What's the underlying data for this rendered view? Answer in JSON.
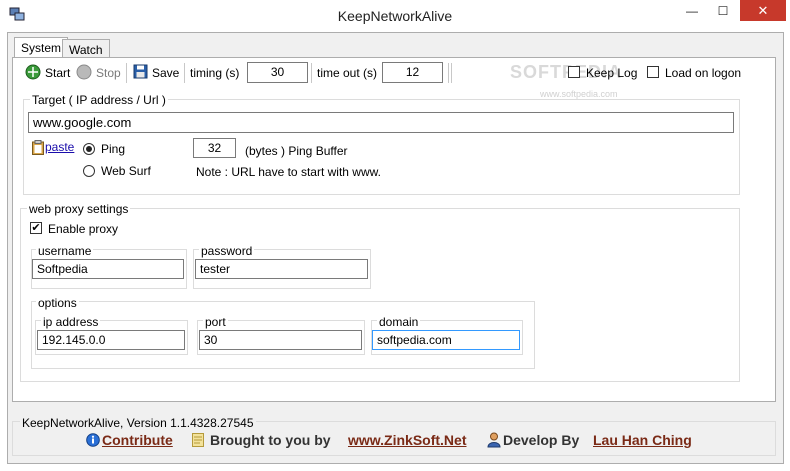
{
  "window": {
    "title": "KeepNetworkAlive",
    "minimize_glyph": "—",
    "maximize_glyph": "☐",
    "close_glyph": "✕"
  },
  "tabs": [
    {
      "label": "System"
    },
    {
      "label": "Watch"
    }
  ],
  "toolbar": {
    "start_label": "Start",
    "stop_label": "Stop",
    "save_label": "Save",
    "timing_label": "timing (s)",
    "timing_value": "30",
    "timeout_label": "time out (s)",
    "timeout_value": "12",
    "keep_log_label": "Keep Log",
    "load_on_logon_label": "Load on logon",
    "watermark": "SOFTPEDIA",
    "watermark_url": "www.softpedia.com"
  },
  "target": {
    "group_label": "Target ( IP address / Url )",
    "url_value": "www.google.com",
    "paste_label": "paste",
    "ping_label": "Ping",
    "web_surf_label": "Web Surf",
    "buffer_value": "32",
    "buffer_label": "(bytes ) Ping Buffer",
    "note": "Note : URL have to start with www."
  },
  "proxy": {
    "group_label": "web proxy settings",
    "enable_label": "Enable proxy",
    "username_label": "username",
    "username_value": "Softpedia",
    "password_label": "password",
    "password_value": "tester",
    "options_label": "options",
    "ip_label": "ip address",
    "ip_value": "192.145.0.0",
    "port_label": "port",
    "port_value": "30",
    "domain_label": "domain",
    "domain_value": "softpedia.com"
  },
  "footer": {
    "version": "KeepNetworkAlive, Version 1.1.4328.27545",
    "contribute": "Contribute",
    "brought_by": "Brought to you by",
    "zinksoft": "www.ZinkSoft.Net",
    "develop_by": "Develop By",
    "author": "Lau Han Ching"
  },
  "colors": {
    "close_button": "#c7392b",
    "link": "#1a0dab",
    "footer_link": "#7a2a16",
    "start_icon": "#3a9a3a",
    "save_icon": "#2a5fa8"
  }
}
